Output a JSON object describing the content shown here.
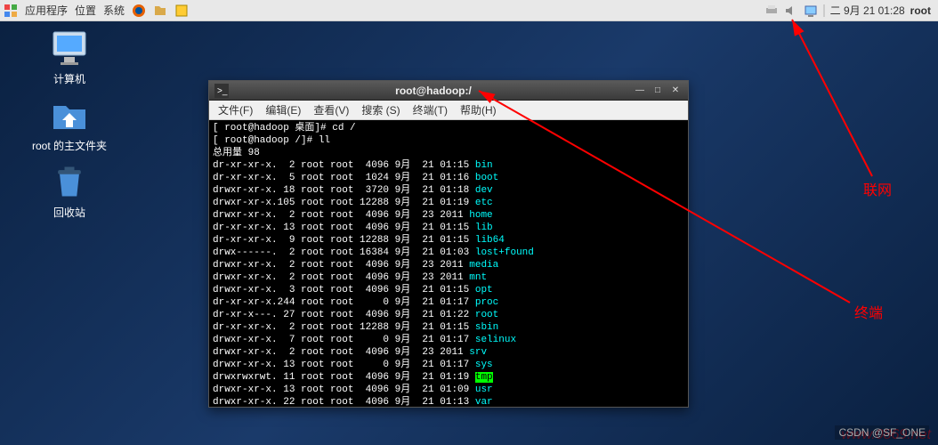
{
  "panel": {
    "apps": "应用程序",
    "places": "位置",
    "system": "系统",
    "datetime": "二  9月 21 01:28",
    "user": "root"
  },
  "desktop": {
    "computer": "计算机",
    "home": "root 的主文件夹",
    "trash": "回收站"
  },
  "terminal": {
    "title": "root@hadoop:/",
    "menu": {
      "file": "文件(F)",
      "edit": "编辑(E)",
      "view": "查看(V)",
      "search": "搜索 (S)",
      "terminal": "终端(T)",
      "help": "帮助(H)"
    },
    "lines": [
      {
        "prefix": "[ root@hadoop 桌面]# ",
        "cmd": "cd /"
      },
      {
        "prefix": "[ root@hadoop /]# ",
        "cmd": "ll"
      },
      {
        "raw": "总用量 98"
      },
      {
        "perm": "dr-xr-xr-x.",
        "n": "  2",
        "own": " root root",
        "size": "  4096",
        "date": " 9月  21 01:15 ",
        "name": "bin",
        "cls": "t-cyan"
      },
      {
        "perm": "dr-xr-xr-x.",
        "n": "  5",
        "own": " root root",
        "size": "  1024",
        "date": " 9月  21 01:16 ",
        "name": "boot",
        "cls": "t-cyan"
      },
      {
        "perm": "drwxr-xr-x.",
        "n": " 18",
        "own": " root root",
        "size": "  3720",
        "date": " 9月  21 01:18 ",
        "name": "dev",
        "cls": "t-cyan"
      },
      {
        "perm": "drwxr-xr-x.",
        "n": "105",
        "own": " root root",
        "size": " 12288",
        "date": " 9月  21 01:19 ",
        "name": "etc",
        "cls": "t-cyan"
      },
      {
        "perm": "drwxr-xr-x.",
        "n": "  2",
        "own": " root root",
        "size": "  4096",
        "date": " 9月  23 2011 ",
        "name": "home",
        "cls": "t-cyan"
      },
      {
        "perm": "dr-xr-xr-x.",
        "n": " 13",
        "own": " root root",
        "size": "  4096",
        "date": " 9月  21 01:15 ",
        "name": "lib",
        "cls": "t-cyan"
      },
      {
        "perm": "dr-xr-xr-x.",
        "n": "  9",
        "own": " root root",
        "size": " 12288",
        "date": " 9月  21 01:15 ",
        "name": "lib64",
        "cls": "t-cyan"
      },
      {
        "perm": "drwx------.",
        "n": "  2",
        "own": " root root",
        "size": " 16384",
        "date": " 9月  21 01:03 ",
        "name": "lost+found",
        "cls": "t-cyan"
      },
      {
        "perm": "drwxr-xr-x.",
        "n": "  2",
        "own": " root root",
        "size": "  4096",
        "date": " 9月  23 2011 ",
        "name": "media",
        "cls": "t-cyan"
      },
      {
        "perm": "drwxr-xr-x.",
        "n": "  2",
        "own": " root root",
        "size": "  4096",
        "date": " 9月  23 2011 ",
        "name": "mnt",
        "cls": "t-cyan"
      },
      {
        "perm": "drwxr-xr-x.",
        "n": "  3",
        "own": " root root",
        "size": "  4096",
        "date": " 9月  21 01:15 ",
        "name": "opt",
        "cls": "t-cyan"
      },
      {
        "perm": "dr-xr-xr-x.",
        "n": "244",
        "own": " root root",
        "size": "     0",
        "date": " 9月  21 01:17 ",
        "name": "proc",
        "cls": "t-cyan"
      },
      {
        "perm": "dr-xr-x---.",
        "n": " 27",
        "own": " root root",
        "size": "  4096",
        "date": " 9月  21 01:22 ",
        "name": "root",
        "cls": "t-cyan"
      },
      {
        "perm": "dr-xr-xr-x.",
        "n": "  2",
        "own": " root root",
        "size": " 12288",
        "date": " 9月  21 01:15 ",
        "name": "sbin",
        "cls": "t-cyan"
      },
      {
        "perm": "drwxr-xr-x.",
        "n": "  7",
        "own": " root root",
        "size": "     0",
        "date": " 9月  21 01:17 ",
        "name": "selinux",
        "cls": "t-cyan"
      },
      {
        "perm": "drwxr-xr-x.",
        "n": "  2",
        "own": " root root",
        "size": "  4096",
        "date": " 9月  23 2011 ",
        "name": "srv",
        "cls": "t-cyan"
      },
      {
        "perm": "drwxr-xr-x.",
        "n": " 13",
        "own": " root root",
        "size": "     0",
        "date": " 9月  21 01:17 ",
        "name": "sys",
        "cls": "t-cyan"
      },
      {
        "perm": "drwxrwxrwt.",
        "n": " 11",
        "own": " root root",
        "size": "  4096",
        "date": " 9月  21 01:19 ",
        "name": "tmp",
        "cls": "t-green-bg"
      },
      {
        "perm": "drwxr-xr-x.",
        "n": " 13",
        "own": " root root",
        "size": "  4096",
        "date": " 9月  21 01:09 ",
        "name": "usr",
        "cls": "t-cyan"
      },
      {
        "perm": "drwxr-xr-x.",
        "n": " 22",
        "own": " root root",
        "size": "  4096",
        "date": " 9月  21 01:13 ",
        "name": "var",
        "cls": "t-cyan"
      }
    ],
    "prompt": "[ root@hadoop /]# "
  },
  "annotations": {
    "network": "联网",
    "terminal_label": "终端"
  },
  "watermark": "www.0869.net",
  "csdn": "CSDN @SF_ONE"
}
